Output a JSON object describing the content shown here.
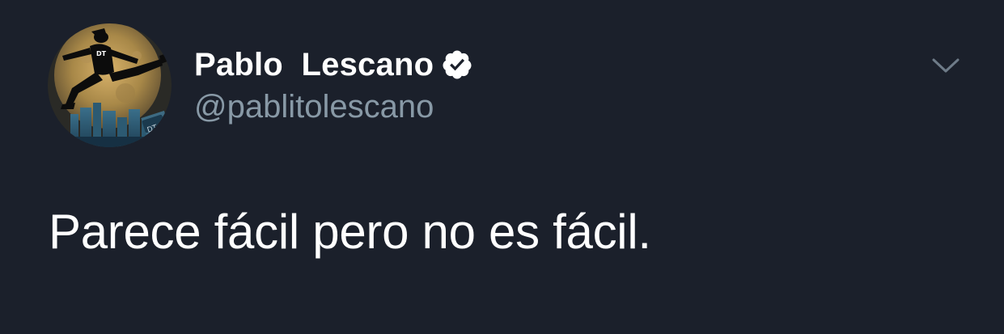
{
  "tweet": {
    "author": {
      "display_name": "Pablo  Lescano",
      "handle": "@pablitolescano",
      "verified": true,
      "avatar_icon": "avatar-silhouette-jump-moon"
    },
    "text": "Parece fácil pero no es fácil.",
    "menu_icon": "chevron-down-icon"
  },
  "colors": {
    "background": "#1b202b",
    "name": "#ffffff",
    "handle": "#8899a6",
    "body_text": "#ffffff",
    "verified_badge": "#ffffff",
    "caret": "#6e7b88"
  }
}
